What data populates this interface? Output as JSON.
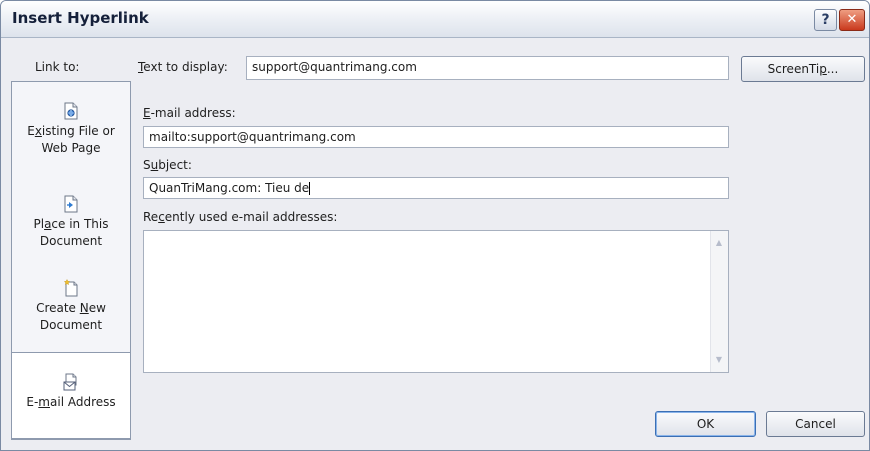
{
  "dialog": {
    "title": "Insert Hyperlink",
    "help_label": "?",
    "close_label": "✕"
  },
  "sidebar": {
    "heading": "Link to:",
    "items": [
      {
        "line1_pre": "E",
        "line1_u": "x",
        "line1_post": "isting File or",
        "line2": "Web Page",
        "icon": "existing-file-icon"
      },
      {
        "line1_pre": "Pl",
        "line1_u": "a",
        "line1_post": "ce in This",
        "line2": "Document",
        "icon": "place-in-document-icon"
      },
      {
        "line1_pre": "Create ",
        "line1_u": "N",
        "line1_post": "ew",
        "line2": "Document",
        "icon": "new-document-icon"
      },
      {
        "line1_pre": "E-",
        "line1_u": "m",
        "line1_post": "ail Address",
        "line2": "",
        "icon": "email-address-icon",
        "selected": true
      }
    ]
  },
  "form": {
    "text_to_display": {
      "label_u": "T",
      "label_rest": "ext to display:",
      "value": "support@quantrimang.com"
    },
    "email": {
      "label_u": "E",
      "label_rest": "-mail address:",
      "value": "mailto:support@quantrimang.com"
    },
    "subject": {
      "label_pre": "S",
      "label_u": "u",
      "label_rest": "bject:",
      "value": "QuanTriMang.com: Tieu de"
    },
    "recent": {
      "label_pre": "Re",
      "label_u": "c",
      "label_rest": "ently used e-mail addresses:",
      "items": []
    }
  },
  "buttons": {
    "screentip": {
      "pre": "ScreenTi",
      "u": "p",
      "post": "..."
    },
    "ok": "OK",
    "cancel": "Cancel"
  },
  "colors": {
    "accent": "#3b6fb4",
    "close": "#c9391d",
    "dialog_bg": "#ecedf2"
  }
}
